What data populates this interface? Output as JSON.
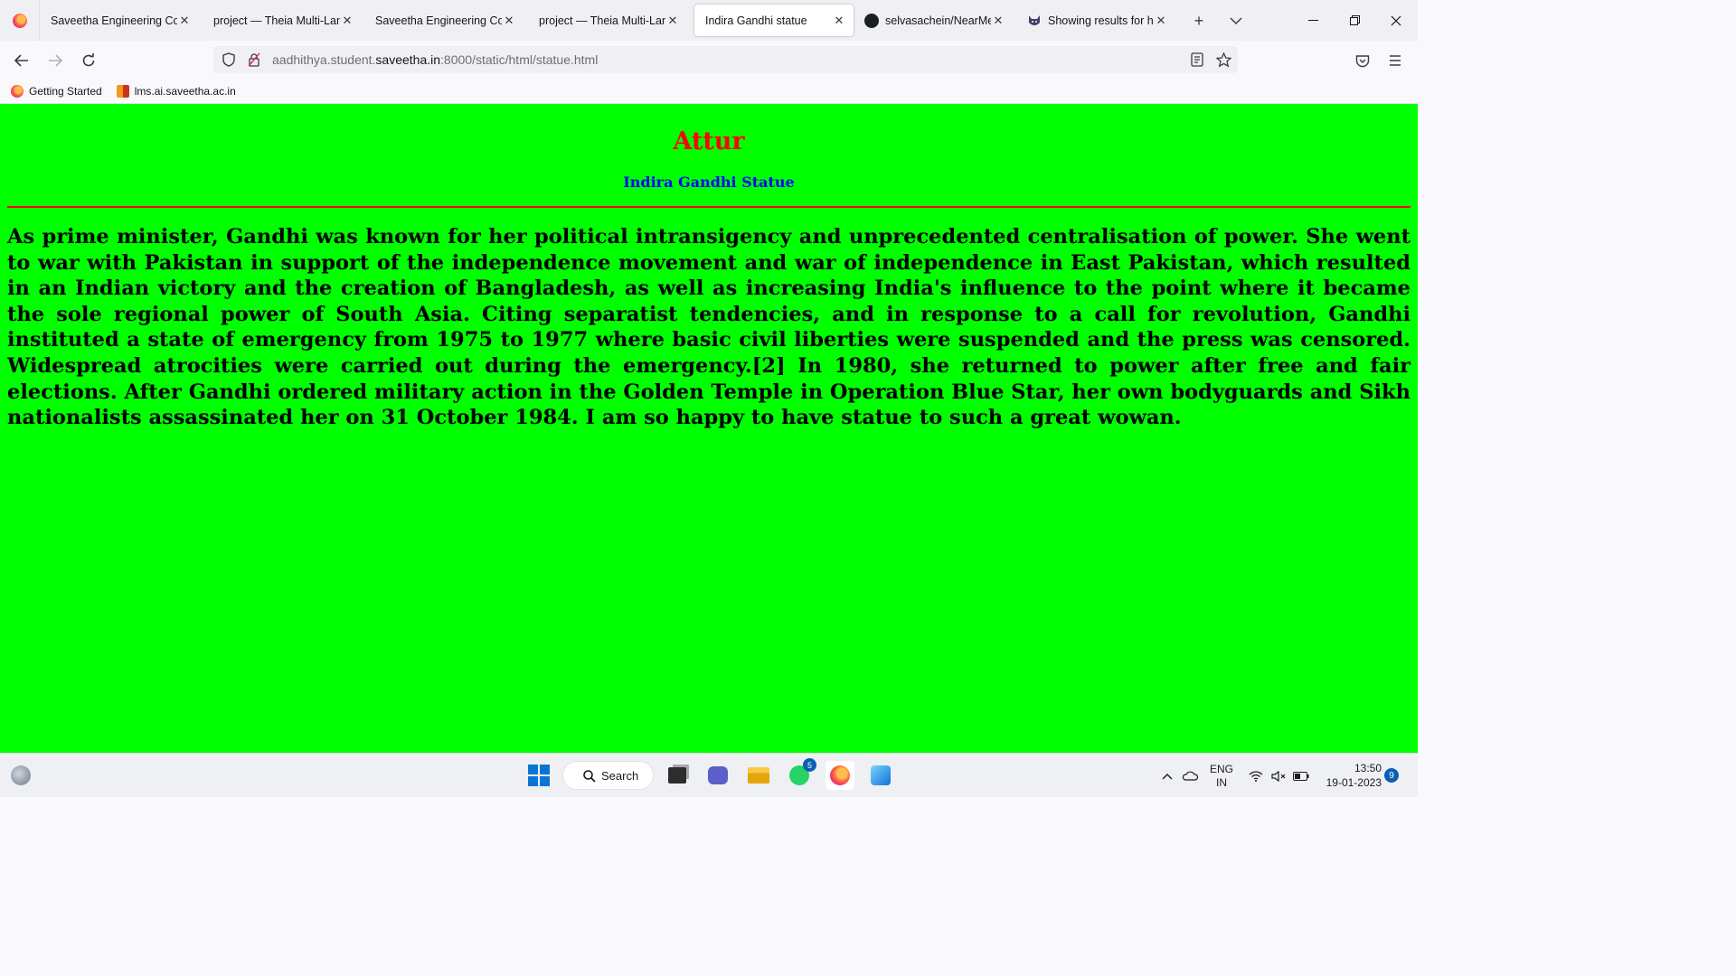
{
  "browser": {
    "tabs": [
      {
        "title": "Saveetha Engineering College",
        "active": false
      },
      {
        "title": "project — Theia Multi-Language",
        "active": false
      },
      {
        "title": "Saveetha Engineering College",
        "active": false
      },
      {
        "title": "project — Theia Multi-Language",
        "active": false
      },
      {
        "title": "Indira Gandhi statue",
        "active": true
      },
      {
        "title": "selvasachein/NearMe",
        "active": false
      },
      {
        "title": "Showing results for https",
        "active": false
      }
    ],
    "url": {
      "prefix": "aadhithya.student.",
      "host": "saveetha.in",
      "suffix": ":8000/static/html/statue.html"
    },
    "bookmarks": [
      {
        "label": "Getting Started"
      },
      {
        "label": "lms.ai.saveetha.ac.in"
      }
    ]
  },
  "page": {
    "heading": "Attur",
    "subheading": "Indira Gandhi Statue",
    "paragraph": "As prime minister, Gandhi was known for her political intransigency and unprecedented centralisation of power. She went to war with Pakistan in support of the independence movement and war of independence in East Pakistan, which resulted in an Indian victory and the creation of Bangladesh, as well as increasing India's influence to the point where it became the sole regional power of South Asia. Citing separatist tendencies, and in response to a call for revolution, Gandhi instituted a state of emergency from 1975 to 1977 where basic civil liberties were suspended and the press was censored. Widespread atrocities were carried out during the emergency.[2] In 1980, she returned to power after free and fair elections. After Gandhi ordered military action in the Golden Temple in Operation Blue Star, her own bodyguards and Sikh nationalists assassinated her on 31 October 1984. I am so happy to have statue to such a great wowan.",
    "colors": {
      "background": "#00ff00",
      "heading": "#ff0000",
      "subheading": "#0000ff",
      "rule": "#ff0000"
    }
  },
  "taskbar": {
    "search_label": "Search",
    "whatsapp_badge": "5",
    "lang_line1": "ENG",
    "lang_line2": "IN",
    "time": "13:50",
    "date": "19-01-2023",
    "notification_count": "9"
  }
}
